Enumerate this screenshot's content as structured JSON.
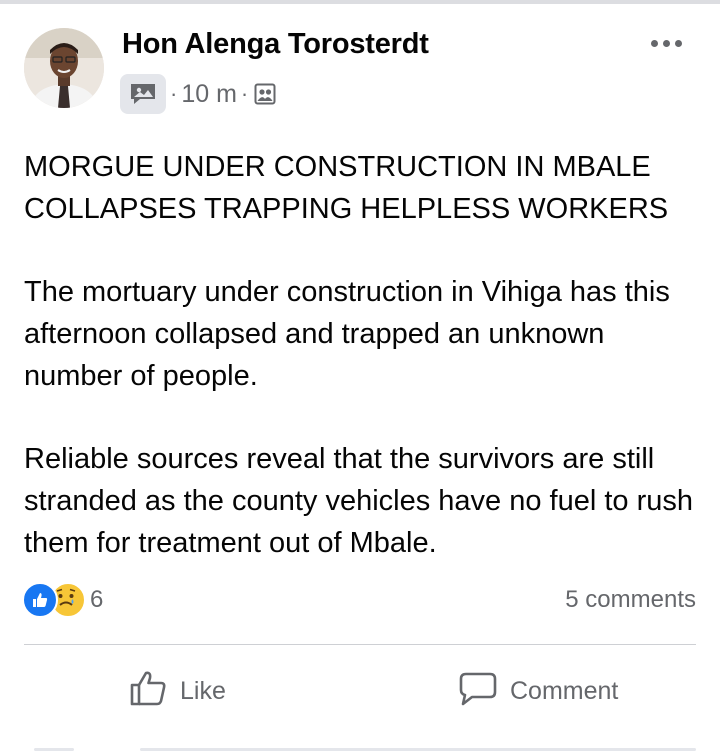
{
  "post": {
    "author": "Hon Alenga Torosterdt",
    "time": "10 m",
    "separator": "·",
    "paragraphs": [
      "MORGUE UNDER CONSTRUCTION IN MBALE COLLAPSES TRAPPING HELPLESS WORKERS",
      "The mortuary under construction in Vihiga has this afternoon collapsed and trapped an unknown number of people.",
      "Reliable sources reveal that the survivors are still stranded as the county vehicles have no fuel to rush them for treatment out of Mbale."
    ]
  },
  "engagement": {
    "reaction_count": "6",
    "comments": "5 comments"
  },
  "actions": {
    "like": "Like",
    "comment": "Comment"
  },
  "icons": {
    "more": "more-options-icon",
    "group": "group-post-icon",
    "audience": "group-audience-icon",
    "like_reaction": "thumbs-up-reaction-icon",
    "sad_reaction": "sad-reaction-icon",
    "like_action": "thumbs-up-icon",
    "comment_action": "comment-bubble-icon"
  },
  "colors": {
    "like_blue": "#1877f2",
    "secondary_text": "#65676b",
    "sad_yellow": "#f7c637"
  }
}
